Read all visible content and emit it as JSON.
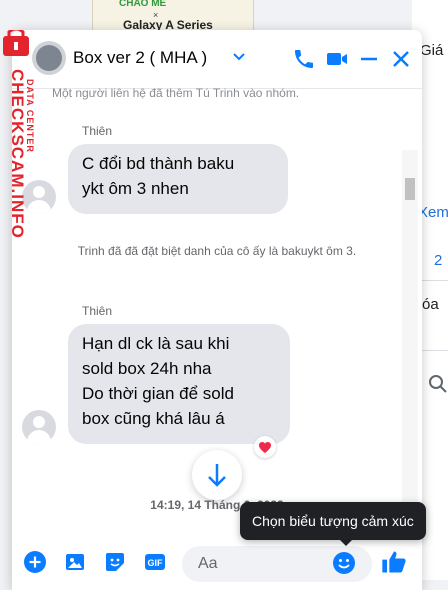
{
  "background": {
    "banner": {
      "line1": "CHÀO MỀ",
      "line2": "×",
      "line3": "Galaxy A Series"
    },
    "right_fragments": [
      "Giá",
      "Xem",
      "2",
      "óa"
    ]
  },
  "chat": {
    "title": "Box ver 2 ( MHA )",
    "top_note": "Một người liên hệ đã thêm Tú Trinh vào nhóm.",
    "messages": [
      {
        "sender": "Thiên",
        "lines": [
          "C đổi bd thành baku",
          "ykt ôm 3 nhen"
        ]
      },
      {
        "sender": "Thiên",
        "lines": [
          "Hạn dl ck là sau khi",
          "sold box 24h nha",
          "Do thời gian để sold",
          "box cũng khá lâu á"
        ],
        "reaction": "❤️"
      }
    ],
    "system_message": "Trinh đã đã đặt biệt danh của cô ấy là bakuykt ôm 3.",
    "timestamp": "14:19, 14 Tháng 6, 2022",
    "composer_placeholder": "Aa",
    "tooltip": "Chọn biểu tượng cảm xúc",
    "accent_color": "#0a7cff"
  },
  "watermark": {
    "text": "CHECKSCAM.INFO",
    "subtext": "DATA CENTER",
    "color": "#e4242c"
  }
}
